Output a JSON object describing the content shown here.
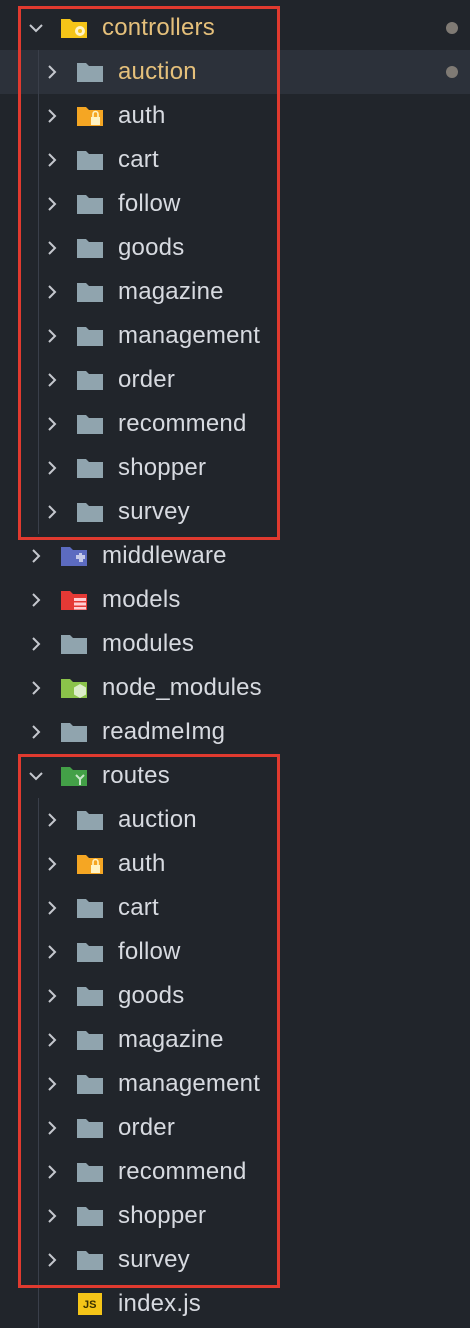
{
  "explorer": {
    "controllers": {
      "label": "controllers",
      "expanded": true,
      "icon": "folder-controller-icon",
      "children": [
        "auction",
        "auth",
        "cart",
        "follow",
        "goods",
        "magazine",
        "management",
        "order",
        "recommend",
        "shopper",
        "survey"
      ]
    },
    "top_level": [
      {
        "label": "middleware",
        "icon": "folder-middleware-icon"
      },
      {
        "label": "models",
        "icon": "folder-database-icon"
      },
      {
        "label": "modules",
        "icon": "folder-icon"
      },
      {
        "label": "node_modules",
        "icon": "folder-node-icon"
      },
      {
        "label": "readmeImg",
        "icon": "folder-icon"
      }
    ],
    "routes": {
      "label": "routes",
      "expanded": true,
      "icon": "folder-routes-icon",
      "children": [
        "auction",
        "auth",
        "cart",
        "follow",
        "goods",
        "magazine",
        "management",
        "order",
        "recommend",
        "shopper",
        "survey"
      ]
    },
    "file": {
      "label": "index.js",
      "badge": "JS",
      "icon": "javascript-file-icon"
    }
  },
  "colors": {
    "background": "#21252b",
    "text": "#d7dae0",
    "modified_accent": "#e5c07b",
    "highlight_box": "#e03a2f",
    "folder_grey": "#90a4ae",
    "auth_folder": "#f5a623",
    "routes_folder": "#43a047",
    "middleware_folder": "#5c6bc0",
    "models_folder": "#e53935",
    "node_folder": "#8bc34a",
    "js_badge": "#f5c518"
  }
}
